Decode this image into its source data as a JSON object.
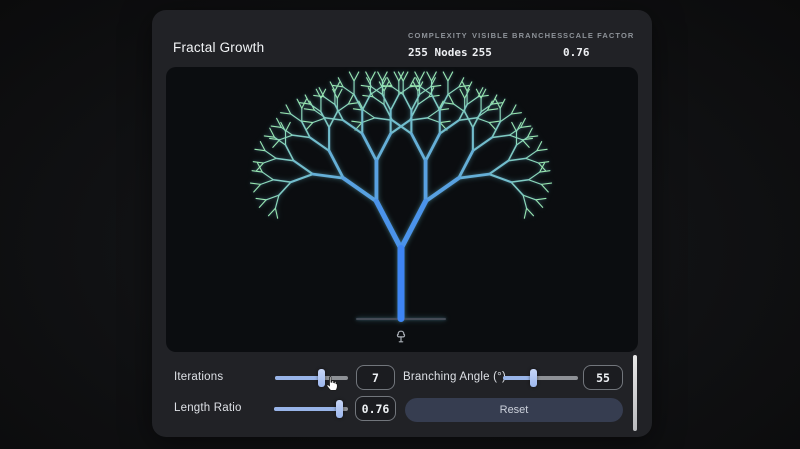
{
  "header": {
    "title": "Fractal Growth",
    "stats": [
      {
        "label": "COMPLEXITY",
        "value": "255 Nodes"
      },
      {
        "label": "VISIBLE BRANCHES",
        "value": "255"
      },
      {
        "label": "SCALE FACTOR",
        "value": "0.76"
      }
    ]
  },
  "controls": {
    "iterations": {
      "label": "Iterations",
      "value": "7",
      "percent": 64
    },
    "branching_angle": {
      "label": "Branching Angle (°)",
      "value": "55",
      "percent": 40
    },
    "length_ratio": {
      "label": "Length Ratio",
      "value": "0.76",
      "percent": 89
    },
    "reset_label": "Reset"
  },
  "fractal": {
    "iterations": 7,
    "branching_angle_deg": 55,
    "length_ratio": 0.76,
    "trunk_length": 70,
    "trunk_width": 7,
    "node_count": 255,
    "base_color": "#3e85f4",
    "tip_color": "#99e7b0",
    "ground_color": "#454b56"
  },
  "colors": {
    "accent_fill": "#98b4e8",
    "card_bg": "#212226",
    "canvas_bg": "#0b0d10"
  }
}
